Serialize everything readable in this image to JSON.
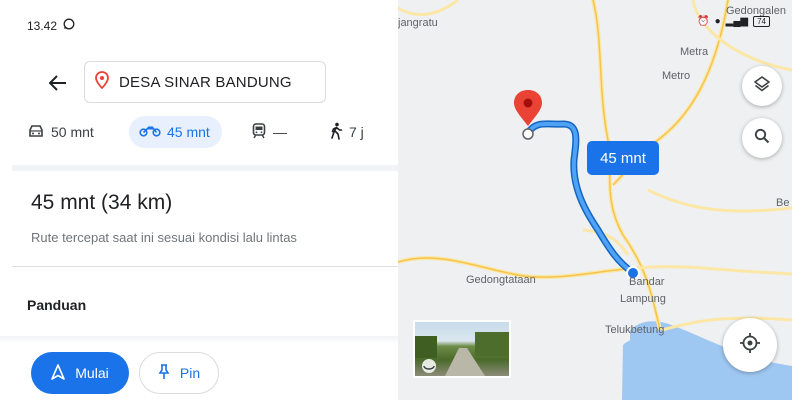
{
  "status_bar": {
    "time": "13.42",
    "whatsapp_icon": "whatsapp-icon"
  },
  "search": {
    "destination": "DESA SINAR BANDUNG"
  },
  "modes": {
    "car": "50 mnt",
    "motorbike": "45 mnt",
    "transit": "—",
    "walk": "7 j"
  },
  "route": {
    "time": "45 mnt (34 km)",
    "description": "Rute tercepat saat ini sesuai kondisi lalu lintas"
  },
  "guide_label": "Panduan",
  "buttons": {
    "start": "Mulai",
    "pin": "Pin"
  },
  "map": {
    "labels": {
      "jangratu": "jangratu",
      "gedongalen": "Gedongalen",
      "metra": "Metra",
      "metro": "Metro",
      "be": "Be",
      "gedongtataan": "Gedongtataan",
      "bandar": "Bandar",
      "lampung": "Lampung",
      "telukbetung": "Telukbetung"
    },
    "route_time_badge": "45 mnt",
    "status_icons": {
      "battery": "74"
    }
  },
  "colors": {
    "accent": "#1a73e8",
    "route": "#4285f4",
    "pin": "#ea4335"
  }
}
